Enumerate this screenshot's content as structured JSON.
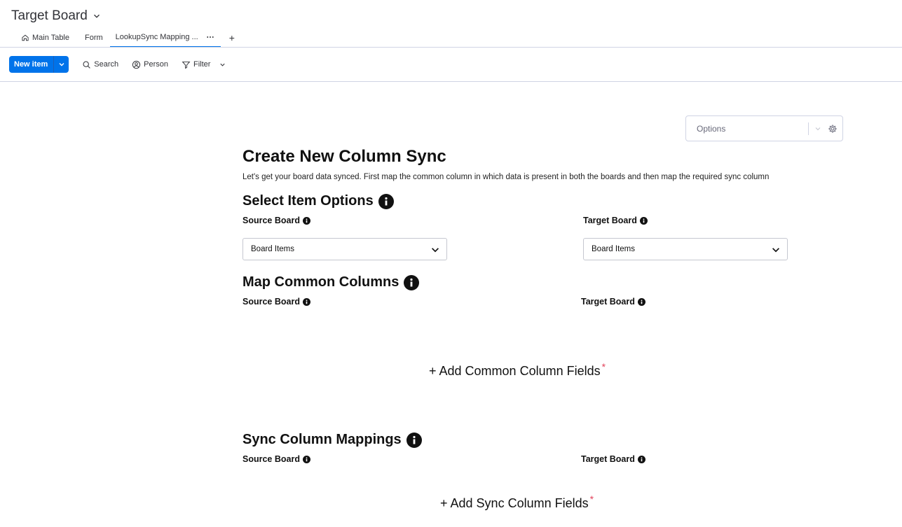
{
  "board": {
    "title": "Target Board"
  },
  "tabs": [
    {
      "label": "Main Table",
      "icon": "home-icon"
    },
    {
      "label": "Form"
    },
    {
      "label": "LookupSync Mapping ...",
      "active": true
    }
  ],
  "tab_add": "+",
  "toolbar": {
    "new_item": "New item",
    "search": "Search",
    "person": "Person",
    "filter": "Filter"
  },
  "options": {
    "placeholder": "Options"
  },
  "page": {
    "title": "Create New Column Sync",
    "subtitle": "Let's get your board data synced. First map the common column in which data is present in both the boards and then map the required sync column"
  },
  "select_item": {
    "heading": "Select Item Options",
    "source_label": "Source Board",
    "target_label": "Target Board",
    "source_value": "Board Items",
    "target_value": "Board Items"
  },
  "common": {
    "heading": "Map Common Columns",
    "source_label": "Source Board",
    "target_label": "Target Board",
    "add_label": "+ Add Common Column Fields",
    "required": "*"
  },
  "sync": {
    "heading": "Sync Column Mappings",
    "source_label": "Source Board",
    "target_label": "Target Board",
    "add_label": "+ Add Sync Column Fields",
    "required": "*"
  },
  "colors": {
    "accent": "#0073ea",
    "required": "#e2445c",
    "border": "#d0d4e4"
  }
}
